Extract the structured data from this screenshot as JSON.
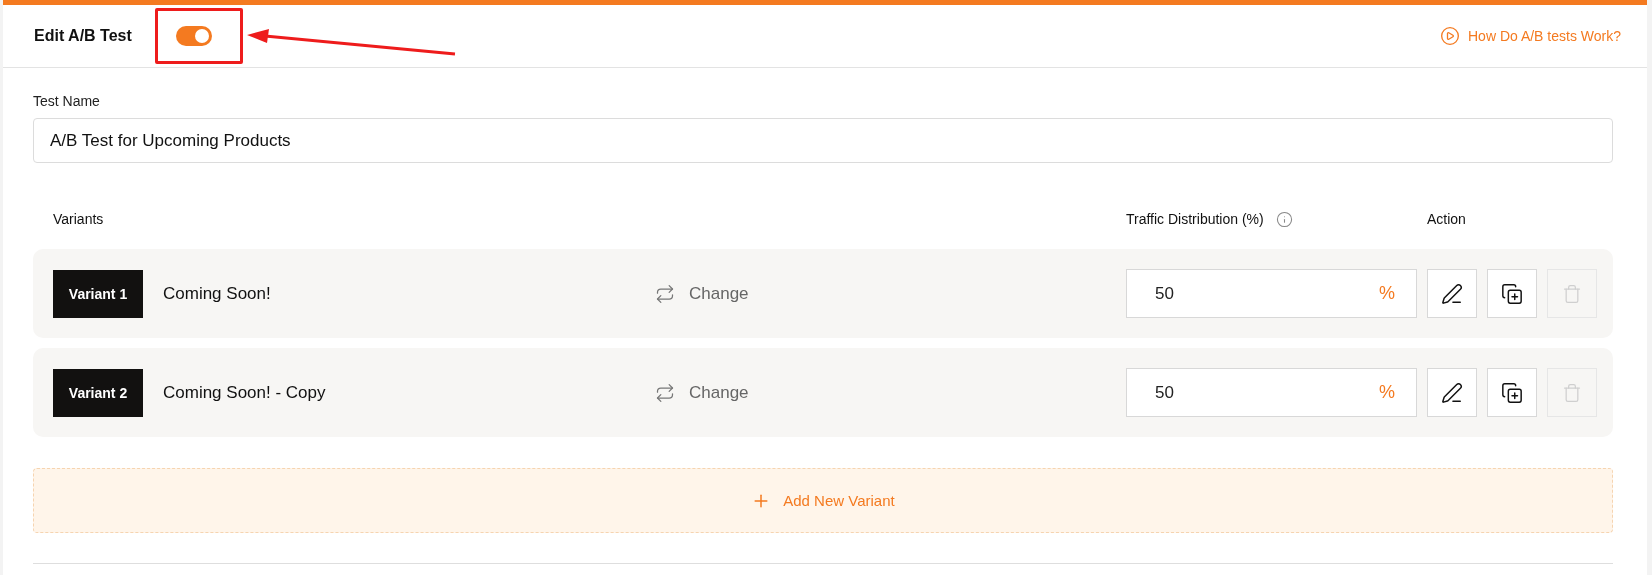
{
  "header": {
    "title": "Edit A/B Test",
    "toggle": {
      "on": true
    },
    "help_link": "How Do A/B tests Work?"
  },
  "test_name": {
    "label": "Test Name",
    "value": "A/B Test for Upcoming Products"
  },
  "variants": {
    "columns": [
      "Variants",
      "Traffic Distribution (%)",
      "Action"
    ],
    "rows": [
      {
        "tag": "Variant 1",
        "name": "Coming Soon!",
        "change_label": "Change",
        "traffic": "50",
        "unit": "%",
        "delete_disabled": true
      },
      {
        "tag": "Variant 2",
        "name": "Coming Soon! - Copy",
        "change_label": "Change",
        "traffic": "50",
        "unit": "%",
        "delete_disabled": true
      }
    ]
  },
  "add_button": "Add New Variant"
}
